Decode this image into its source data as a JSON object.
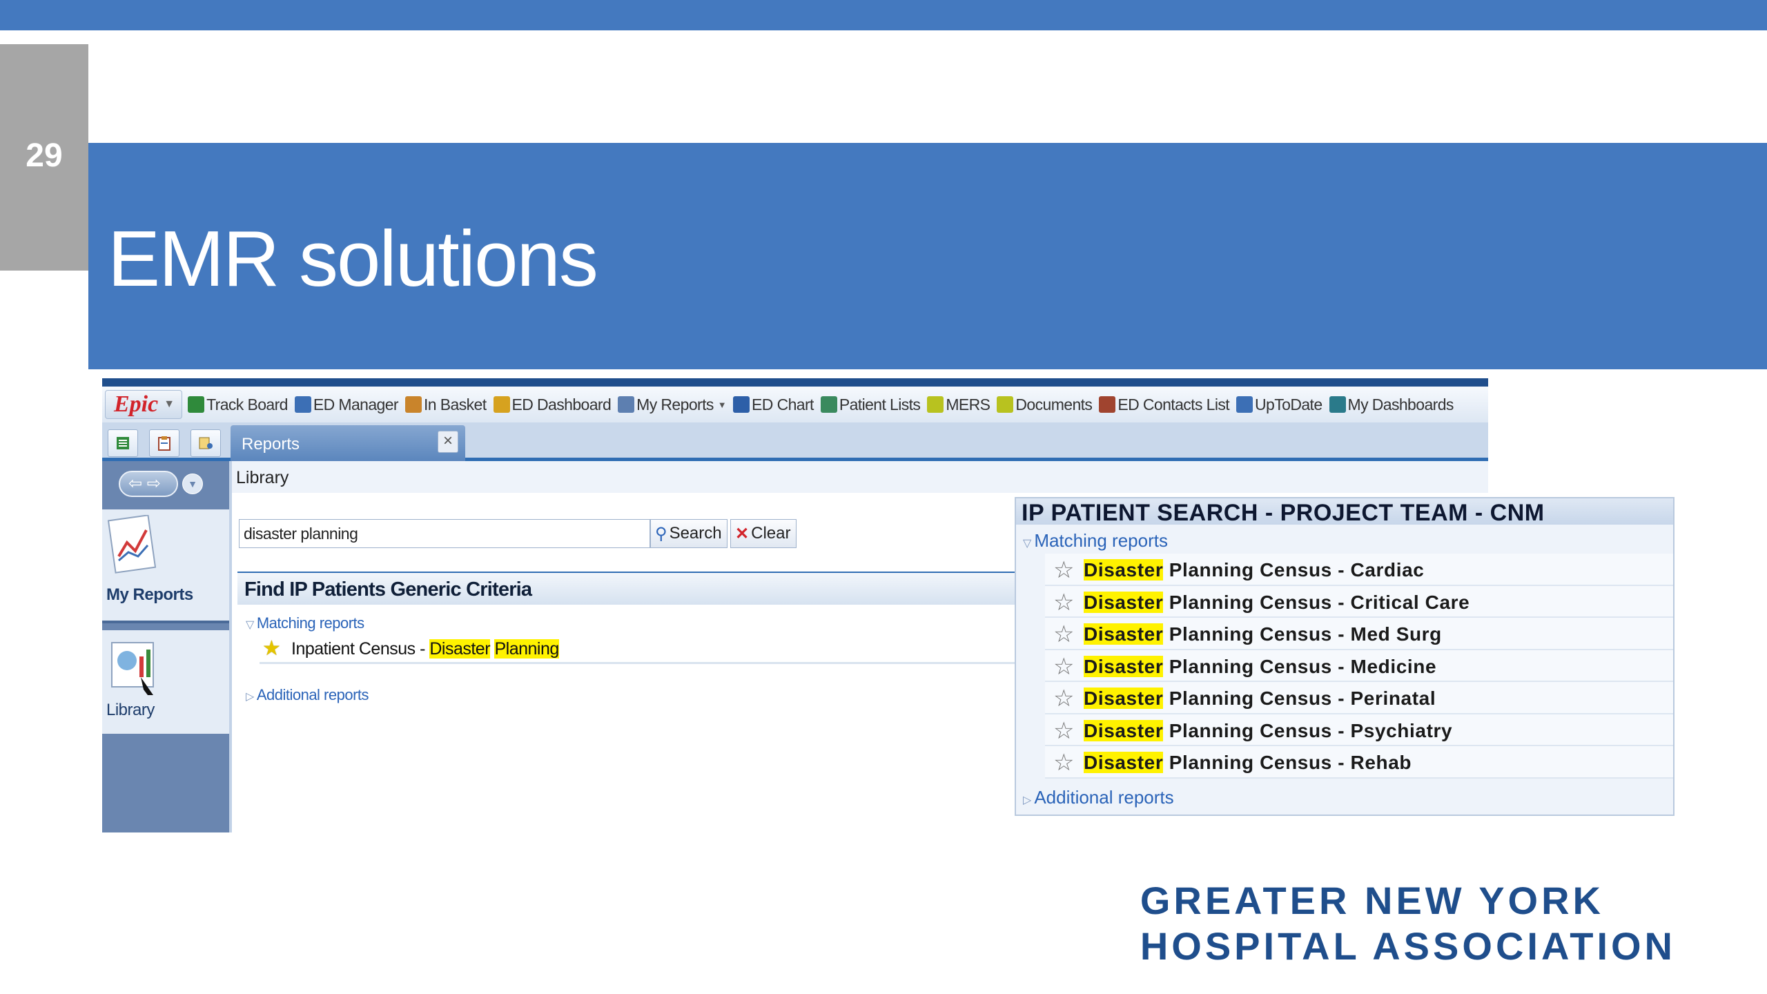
{
  "slide": {
    "number": "29",
    "title": "EMR solutions",
    "accent_color": "#4479bf",
    "number_box_color": "#a6a6a6"
  },
  "epic": {
    "logo": "Epic",
    "menu": [
      {
        "label": "Track Board",
        "icon": "track-board-icon",
        "color": "#2f8a3b"
      },
      {
        "label": "ED Manager",
        "icon": "ed-manager-icon",
        "color": "#3c6fb5"
      },
      {
        "label": "In Basket",
        "icon": "in-basket-icon",
        "color": "#c9842b"
      },
      {
        "label": "ED Dashboard",
        "icon": "ed-dashboard-icon",
        "color": "#d6a21f"
      },
      {
        "label": "My Reports",
        "icon": "my-reports-icon",
        "color": "#5d7fb0"
      },
      {
        "label": "ED Chart",
        "icon": "ed-chart-icon",
        "color": "#2d5fa8"
      },
      {
        "label": "Patient Lists",
        "icon": "patient-lists-icon",
        "color": "#3a8a5e"
      },
      {
        "label": "MERS",
        "icon": "mers-icon",
        "color": "#b8c21f"
      },
      {
        "label": "Documents",
        "icon": "documents-icon",
        "color": "#b8c21f"
      },
      {
        "label": "ED Contacts List",
        "icon": "ed-contacts-icon",
        "color": "#a0442f"
      },
      {
        "label": "UpToDate",
        "icon": "uptodate-icon",
        "color": "#3c6fb5"
      },
      {
        "label": "My Dashboards",
        "icon": "my-dashboards-icon",
        "color": "#2a7a8a"
      }
    ],
    "tab": {
      "label": "Reports",
      "close": "×"
    },
    "sidebar": {
      "my_reports": "My Reports",
      "library": "Library"
    },
    "library": {
      "title": "Library",
      "search_value": "disaster planning",
      "search_button": "Search",
      "clear_button": "Clear",
      "criteria_title": "Find IP Patients Generic Criteria",
      "matching_label": "Matching reports",
      "report": {
        "prefix": "Inpatient Census - ",
        "hl1": "Disaster",
        "hl2": "Planning"
      },
      "additional_label": "Additional reports"
    }
  },
  "overlay": {
    "title": "IP PATIENT SEARCH - PROJECT TEAM - CNM",
    "matching_label": "Matching reports",
    "highlight": "Disaster",
    "reports": [
      " Planning Census - Cardiac",
      " Planning Census - Critical Care",
      " Planning Census - Med Surg",
      " Planning Census - Medicine",
      " Planning Census - Perinatal",
      " Planning Census - Psychiatry",
      " Planning Census - Rehab"
    ],
    "additional_label": "Additional reports"
  },
  "footer": {
    "line1": "GREATER NEW YORK",
    "line2": "HOSPITAL ASSOCIATION"
  }
}
